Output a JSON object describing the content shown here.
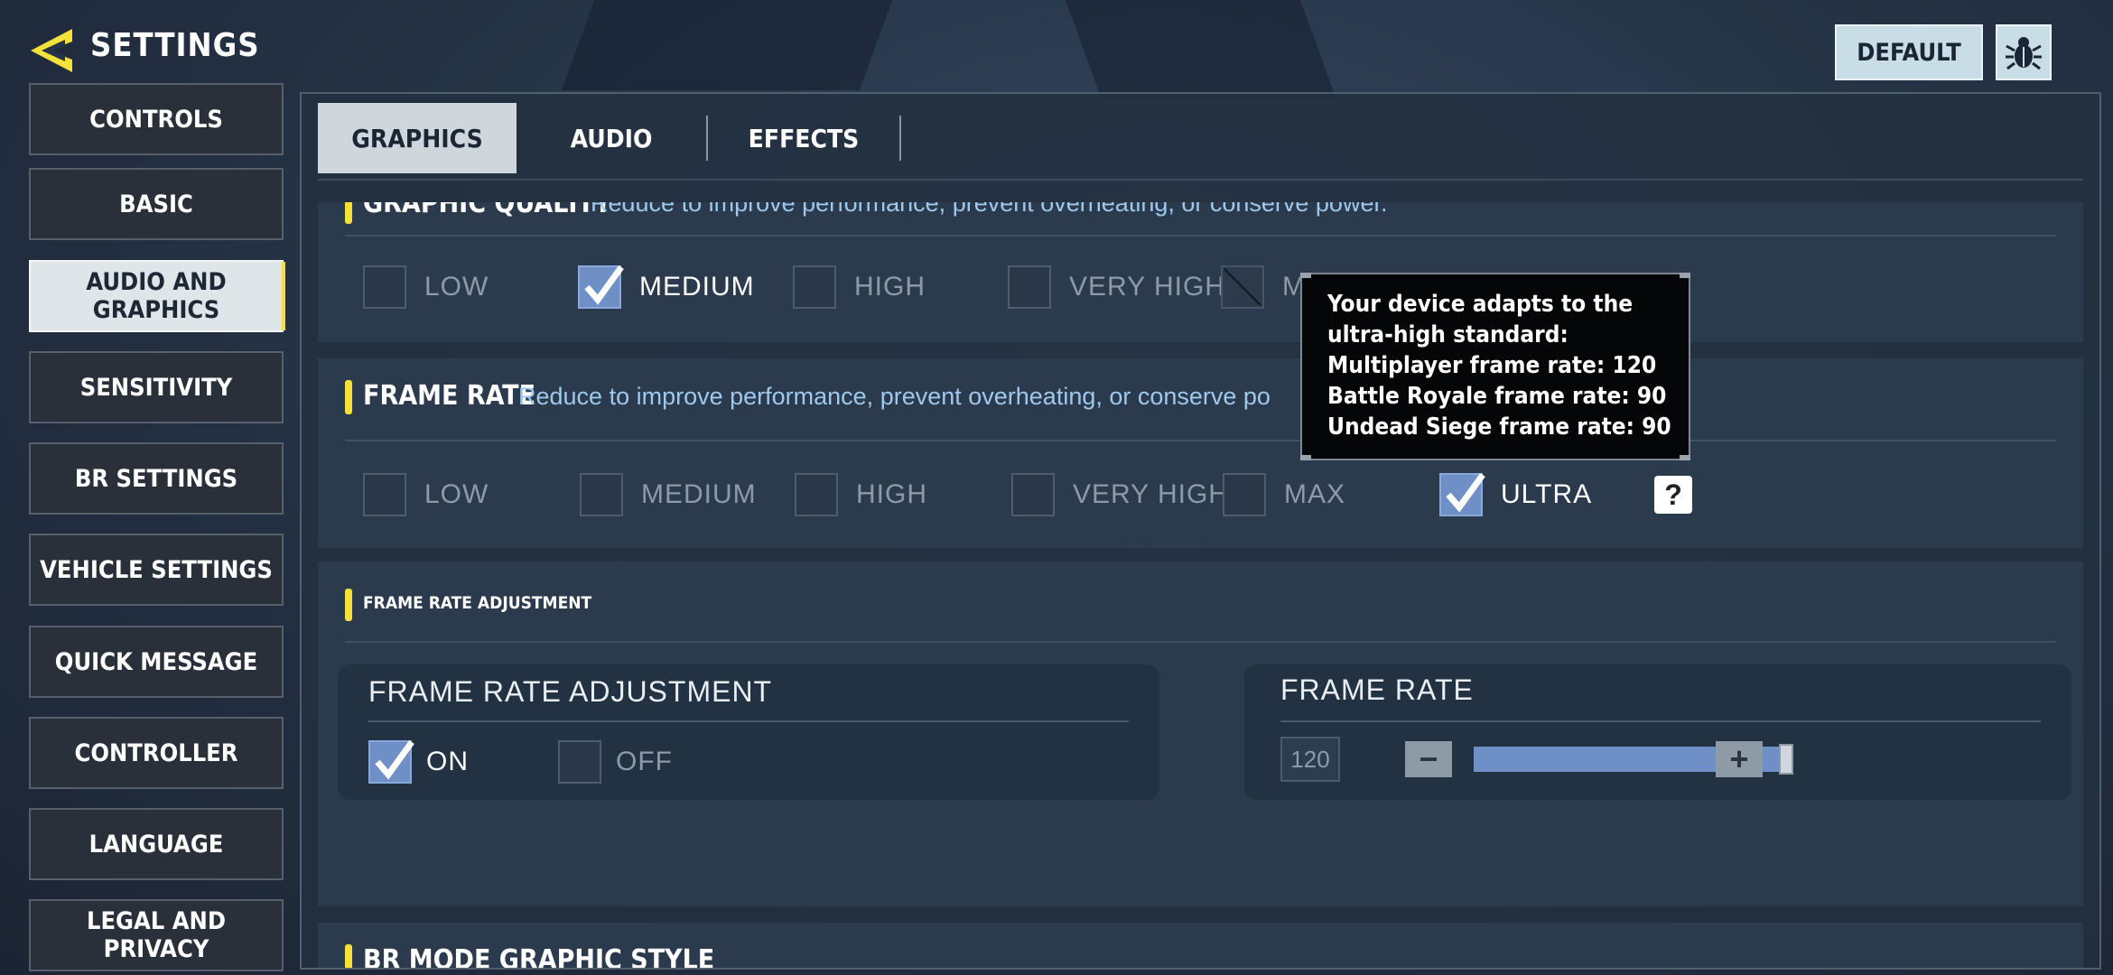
{
  "header": {
    "title": "SETTINGS",
    "default_label": "DEFAULT"
  },
  "sidebar": {
    "items": [
      {
        "label": "CONTROLS"
      },
      {
        "label": "BASIC"
      },
      {
        "label": "AUDIO AND GRAPHICS",
        "active": true
      },
      {
        "label": "SENSITIVITY"
      },
      {
        "label": "BR SETTINGS"
      },
      {
        "label": "VEHICLE SETTINGS"
      },
      {
        "label": "QUICK MESSAGE"
      },
      {
        "label": "CONTROLLER"
      },
      {
        "label": "LANGUAGE"
      },
      {
        "label": "LEGAL AND PRIVACY"
      }
    ]
  },
  "tabs": [
    {
      "label": "GRAPHICS",
      "active": true
    },
    {
      "label": "AUDIO"
    },
    {
      "label": "EFFECTS"
    }
  ],
  "graphic_quality": {
    "title": "GRAPHIC QUALITY",
    "description": "Reduce to improve performance, prevent overheating, or conserve power.",
    "options": [
      {
        "label": "LOW",
        "checked": false
      },
      {
        "label": "MEDIUM",
        "checked": true
      },
      {
        "label": "HIGH",
        "checked": false
      },
      {
        "label": "VERY HIGH",
        "checked": false
      },
      {
        "label": "MAX",
        "checked": false,
        "disabled": true
      }
    ]
  },
  "frame_rate": {
    "title": "FRAME RATE",
    "description": "Reduce to improve performance, prevent overheating, or conserve po",
    "options": [
      {
        "label": "LOW",
        "checked": false
      },
      {
        "label": "MEDIUM",
        "checked": false
      },
      {
        "label": "HIGH",
        "checked": false
      },
      {
        "label": "VERY HIGH",
        "checked": false
      },
      {
        "label": "MAX",
        "checked": false
      },
      {
        "label": "ULTRA",
        "checked": true
      }
    ],
    "help_label": "?"
  },
  "frame_rate_adjustment": {
    "section_title": "FRAME RATE ADJUSTMENT",
    "card_title": "FRAME RATE ADJUSTMENT",
    "on_label": "ON",
    "off_label": "OFF",
    "on_checked": true,
    "fr_card_title": "FRAME RATE",
    "fr_value": "120",
    "fr_slider_fraction": 1.0,
    "minus_label": "−",
    "plus_label": "+"
  },
  "br_mode": {
    "title": "BR MODE GRAPHIC STYLE"
  },
  "tooltip": {
    "lines": [
      "Your device adapts to the",
      "ultra-high standard:",
      "Multiplayer frame rate: 120",
      "Battle Royale frame rate: 90",
      "Undead Siege frame rate: 90"
    ]
  },
  "colors": {
    "accent_yellow": "#f3e23a",
    "checked_blue": "#6f8fc7",
    "description_blue": "#9ec8ec"
  }
}
